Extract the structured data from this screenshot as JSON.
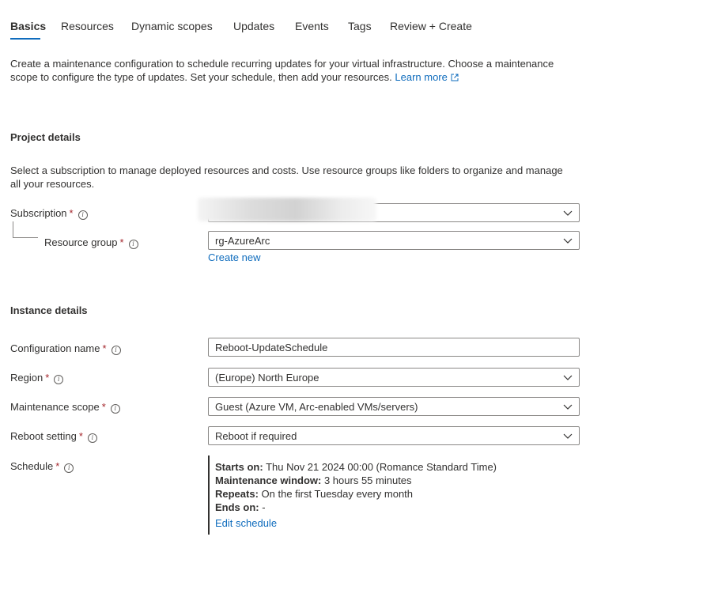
{
  "tabs": [
    {
      "label": "Basics",
      "active": true
    },
    {
      "label": "Resources"
    },
    {
      "label": "Dynamic scopes"
    },
    {
      "label": "Updates"
    },
    {
      "label": "Events"
    },
    {
      "label": "Tags"
    },
    {
      "label": "Review + Create"
    }
  ],
  "intro": {
    "text": "Create a maintenance configuration to schedule recurring updates for your virtual infrastructure. Choose a maintenance scope to configure the type of updates. Set your schedule, then add your resources.",
    "learn_more": "Learn more"
  },
  "project": {
    "title": "Project details",
    "description": "Select a subscription to manage deployed resources and costs. Use resource groups like folders to organize and manage all your resources.",
    "subscription_label": "Subscription",
    "subscription_value": "",
    "resource_group_label": "Resource group",
    "resource_group_value": "rg-AzureArc",
    "create_new": "Create new"
  },
  "instance": {
    "title": "Instance details",
    "config_name_label": "Configuration name",
    "config_name_value": "Reboot-UpdateSchedule",
    "region_label": "Region",
    "region_value": "(Europe) North Europe",
    "scope_label": "Maintenance scope",
    "scope_value": "Guest (Azure VM, Arc-enabled VMs/servers)",
    "reboot_label": "Reboot setting",
    "reboot_value": "Reboot if required",
    "schedule_label": "Schedule"
  },
  "schedule": {
    "starts_label": "Starts on:",
    "starts_value": "Thu Nov 21 2024 00:00 (Romance Standard Time)",
    "window_label": "Maintenance window:",
    "window_value": "3 hours 55 minutes",
    "repeats_label": "Repeats:",
    "repeats_value": "On the first Tuesday every month",
    "ends_label": "Ends on:",
    "ends_value": "-",
    "edit": "Edit schedule"
  },
  "required_mark": "*",
  "icons": {
    "info": "info-icon",
    "chevron": "chevron-down-icon",
    "external": "external-link-icon"
  },
  "colors": {
    "accent": "#0f6cbd",
    "required": "#a4262c"
  }
}
